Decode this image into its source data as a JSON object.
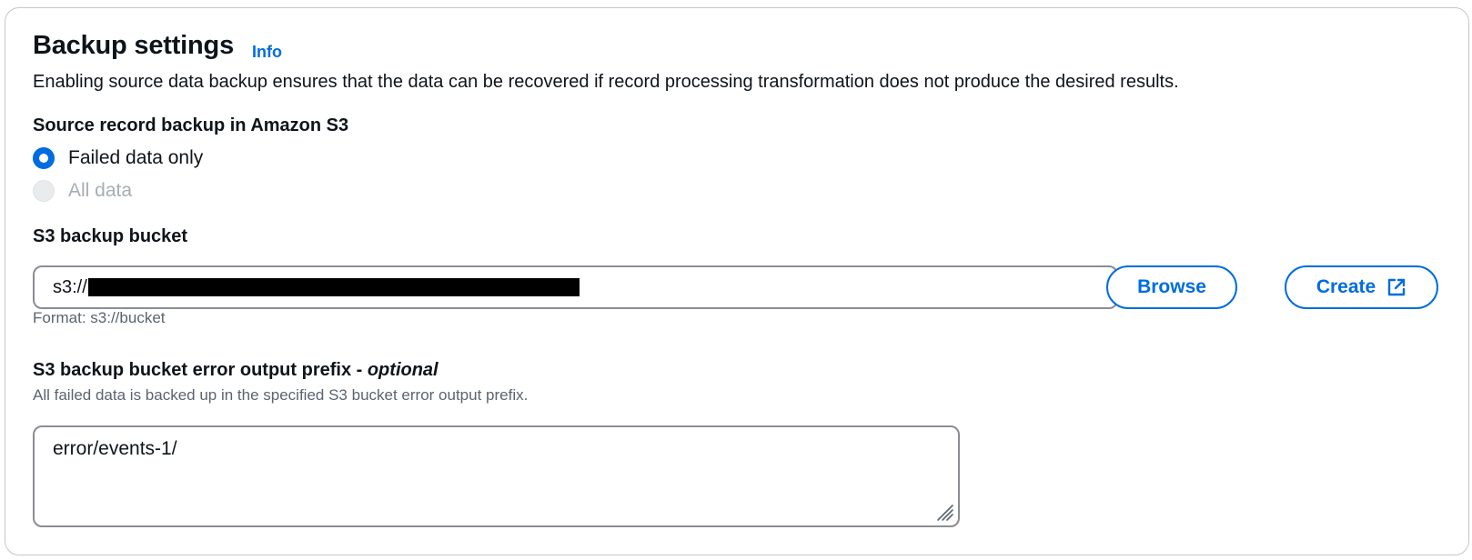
{
  "header": {
    "title": "Backup settings",
    "info_link": "Info",
    "description": "Enabling source data backup ensures that the data can be recovered if record processing transformation does not produce the desired results."
  },
  "source_backup": {
    "label": "Source record backup in Amazon S3",
    "options": [
      {
        "label": "Failed data only",
        "selected": true,
        "disabled": false
      },
      {
        "label": "All data",
        "selected": false,
        "disabled": true
      }
    ]
  },
  "bucket": {
    "label": "S3 backup bucket",
    "value_prefix": "s3://",
    "value_redacted": true,
    "format_hint": "Format: s3://bucket",
    "browse_label": "Browse",
    "create_label": "Create",
    "create_icon": "external-link-icon"
  },
  "error_prefix": {
    "label": "S3 backup bucket error output prefix - ",
    "label_optional": "optional",
    "description": "All failed data is backed up in the specified S3 bucket error output prefix.",
    "value": "error/events-1/"
  },
  "colors": {
    "accent": "#006ce0",
    "border": "#8c8c94",
    "text": "#0f141a",
    "muted": "#5b6470",
    "disabled": "#a8adb5"
  }
}
